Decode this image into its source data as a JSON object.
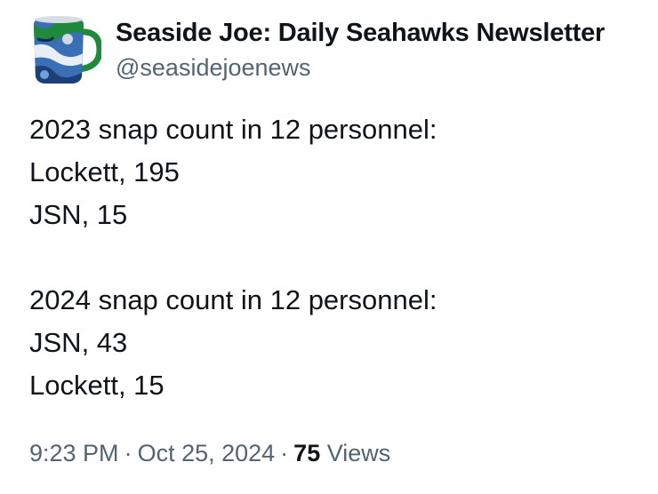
{
  "author": {
    "display_name": "Seaside Joe: Daily Seahawks Newsletter",
    "handle": "@seasidejoenews",
    "avatar_icon": "green-mug-avatar-icon"
  },
  "tweet": {
    "lines": [
      "2023 snap count in 12 personnel:",
      "Lockett, 195",
      "JSN, 15",
      "",
      "2024 snap count in 12 personnel:",
      "JSN, 43",
      "Lockett, 15"
    ]
  },
  "meta": {
    "time": "9:23 PM",
    "separator": "·",
    "date": "Oct 25, 2024",
    "views_count": "75",
    "views_label": "Views"
  },
  "colors": {
    "text_primary": "#0f1419",
    "text_secondary": "#536471",
    "background": "#ffffff",
    "mug_green": "#1f8a3b"
  }
}
